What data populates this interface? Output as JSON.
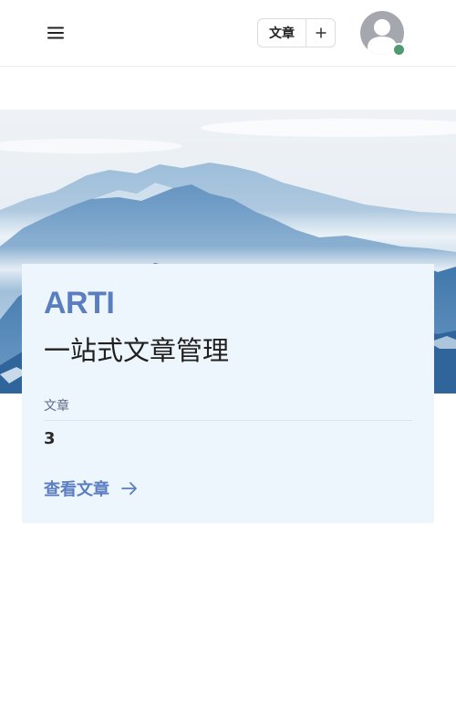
{
  "header": {
    "menu_icon": "hamburger-menu-icon",
    "articles_button_label": "文章",
    "add_icon": "plus-icon",
    "avatar_icon": "user-avatar-icon",
    "status_color": "#4f9a6f"
  },
  "hero": {
    "image": "misty-mountain-range"
  },
  "card": {
    "brand": "ARTI",
    "tagline": "一站式文章管理",
    "stat_label": "文章",
    "stat_value": "3",
    "link_label": "查看文章",
    "link_icon": "arrow-right-icon"
  },
  "colors": {
    "accent": "#5a7ec0",
    "card_background": "#eef6fd",
    "text": "#1f1f1f"
  }
}
